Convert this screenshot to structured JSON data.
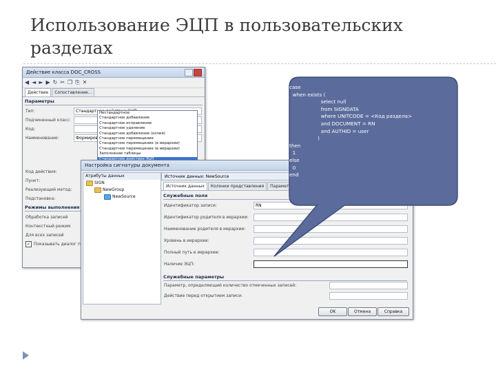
{
  "slide": {
    "title": "Использование ЭЦП в пользовательских разделах"
  },
  "win1": {
    "title": "Действие класса DOC_CROSS",
    "tabs": [
      "Действие",
      "Сопоставление..."
    ],
    "section_params": "Параметры",
    "fields": [
      {
        "label": "Тип:",
        "value": "Стандартное действие ЭЦП"
      },
      {
        "label": "Подчиненный класс:",
        "value": ""
      },
      {
        "label": "Код:",
        "value": ""
      },
      {
        "label": "Наименование:",
        "value": "Формирование ЭЦП"
      }
    ],
    "dropdown_items": [
      "Нестандартное",
      "Стандартное добавление",
      "Стандартное исправление",
      "Стандартное удаление",
      "Стандартное добавление (копия)",
      "Стандартное перемещение",
      "Стандартное перемещение (в иерархии)",
      "Стандартное перемещение (в иерархии)",
      "Заполнение таблицы",
      "Стандартное действие ЭЦП"
    ],
    "more_labels": [
      "Код действия:",
      "Пункт:",
      "Реализующий метод:",
      "Подстановка:"
    ],
    "section_modes": "Режимы выполнения",
    "mode_items": [
      "Обработка записей",
      "Контекстный режим",
      "Для всех записей"
    ],
    "checkbox_label": "Показывать диалог при..."
  },
  "win2": {
    "title": "Настройка сигнатуры документа",
    "tree_items": [
      "Атрибуты данных",
      "SIGN",
      "NewGroup",
      "NewSource"
    ],
    "tabs": [
      "Источник данных",
      "Колонки представления",
      "Парамет..."
    ],
    "inner_tab": "Источник данных: NewSource",
    "section_service": "Служебные поля",
    "fields": [
      {
        "label": "Идентификатор записи:",
        "value": "RN"
      },
      {
        "label": "Идентификатор родителя в иерархии:",
        "value": ""
      },
      {
        "label": "Наименование родителя в иерархии:",
        "value": ""
      },
      {
        "label": "Уровень в иерархии:",
        "value": ""
      },
      {
        "label": "Полный путь в иерархии:",
        "value": ""
      },
      {
        "label": "Наличие ЭЦП:",
        "value": ""
      }
    ],
    "section_params": "Служебные параметры",
    "param_fields": [
      {
        "label": "Параметр, определяющий количество отмеченных записей:",
        "value": ""
      },
      {
        "label": "Действие перед открытием записи:",
        "value": ""
      }
    ],
    "buttons": {
      "ok": "OK",
      "cancel": "Отмена",
      "help": "Справка"
    }
  },
  "callout": {
    "text": "case\n  when exists (\n                    select null\n                    from SIGNDATA\n                    where UNITCODE = <Код раздела>\n                    and DOCUMENT = RN\n                    and AUTHID = user\n                  )\nthen\n  1\nelse\n  0\nend"
  },
  "colors": {
    "callout_fill": "#5b6c9c",
    "callout_stroke": "#3e4d78",
    "title_text": "#3a3a3a",
    "accent_blue": "#3c77d2"
  },
  "icons": [
    "back-icon",
    "forward-icon",
    "first-icon",
    "last-icon",
    "refresh-icon",
    "cut-icon",
    "copy-icon",
    "paste-icon",
    "delete-icon",
    "folder-icon",
    "bullet-arrow-icon"
  ]
}
